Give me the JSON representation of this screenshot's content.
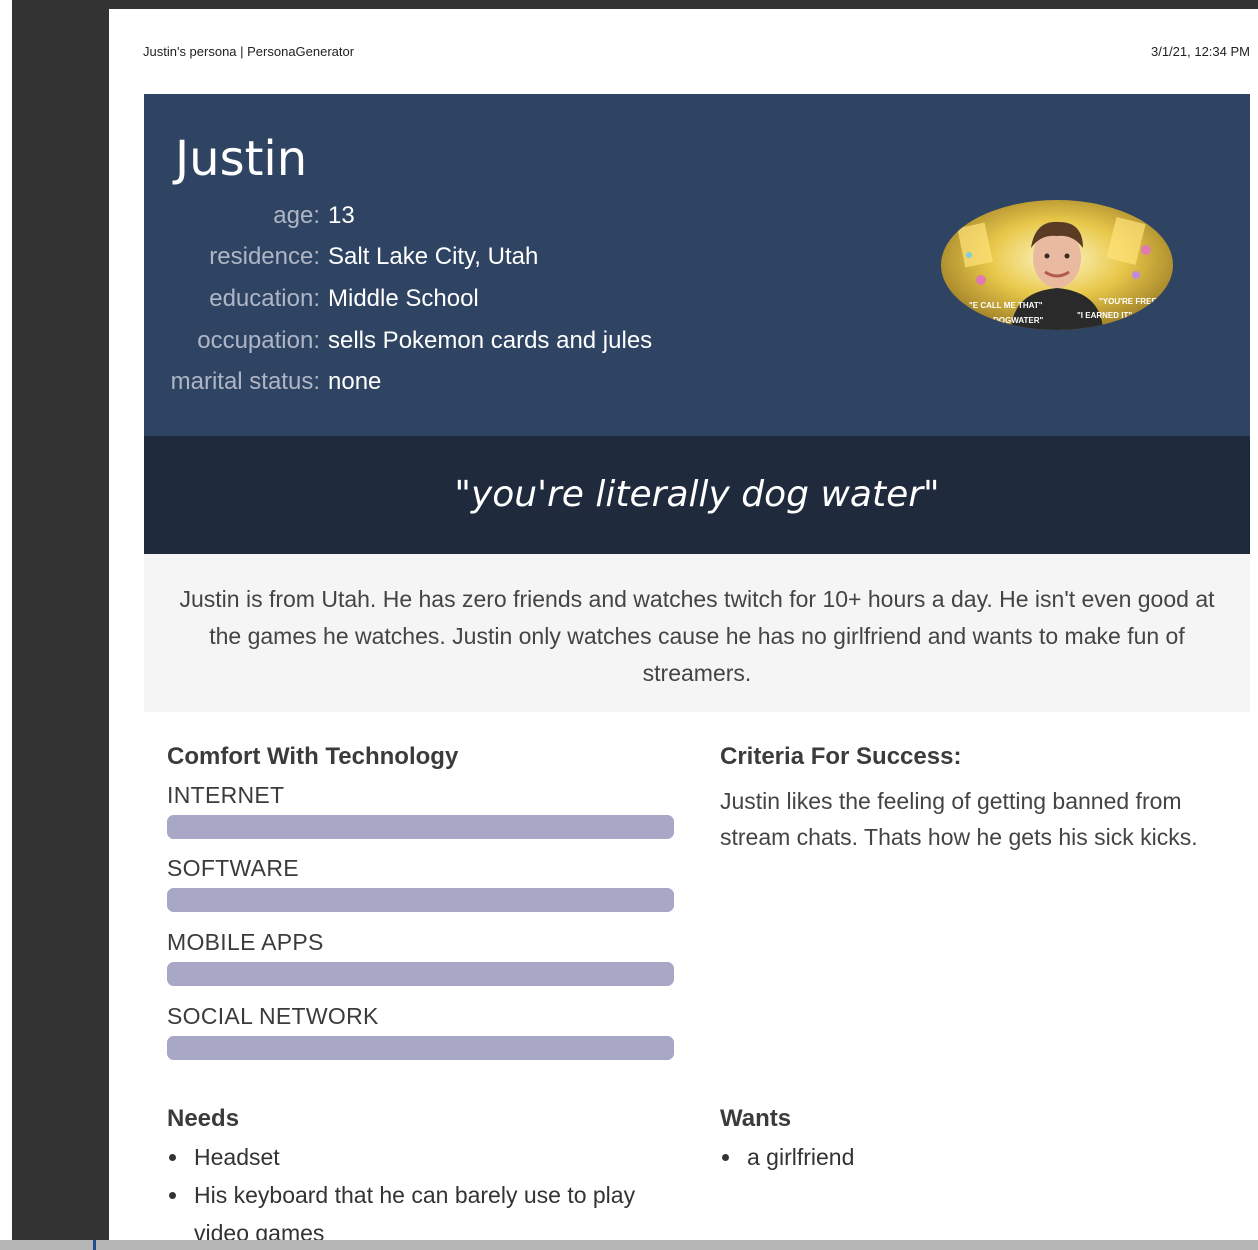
{
  "header": {
    "page_title": "Justin's persona | PersonaGenerator",
    "timestamp": "3/1/21, 12:34 PM"
  },
  "persona": {
    "name": "Justin",
    "facts": [
      {
        "label": "age:",
        "value": "13"
      },
      {
        "label": "residence:",
        "value": "Salt Lake City, Utah"
      },
      {
        "label": "education:",
        "value": "Middle School"
      },
      {
        "label": "occupation:",
        "value": "sells Pokemon cards and jules"
      },
      {
        "label": "marital status:",
        "value": "none"
      }
    ],
    "photo": {
      "icon": "persona-photo",
      "caption_left": "\"E CALL ME THAT\" DOGWATER\"",
      "caption_right": "\"YOU'RE FREE\" \"I EARNED IT\""
    },
    "quote": "\"you're literally dog water\"",
    "bio": "Justin is from Utah. He has zero friends and watches twitch for 10+ hours a day. He isn't even good at the games he watches. Justin only watches cause he has no girlfriend and wants to make fun of streamers."
  },
  "comfort": {
    "title": "Comfort With Technology",
    "items": [
      {
        "label": "INTERNET",
        "level": 1.0
      },
      {
        "label": "SOFTWARE",
        "level": 1.0
      },
      {
        "label": "MOBILE APPS",
        "level": 1.0
      },
      {
        "label": "SOCIAL NETWORK",
        "level": 1.0
      }
    ]
  },
  "criteria": {
    "title": "Criteria For Success:",
    "text": "Justin likes the feeling of getting banned from stream chats. Thats how he gets his sick kicks."
  },
  "needs": {
    "title": "Needs",
    "items": [
      "Headset",
      "His keyboard that he can barely use to play video games"
    ]
  },
  "wants": {
    "title": "Wants",
    "items": [
      "a girlfriend"
    ]
  },
  "colors": {
    "hero_bg": "#2f4462",
    "quote_bg": "#1f2a3c",
    "bio_bg": "#f5f5f5",
    "bar_color": "#a9a7c6"
  }
}
